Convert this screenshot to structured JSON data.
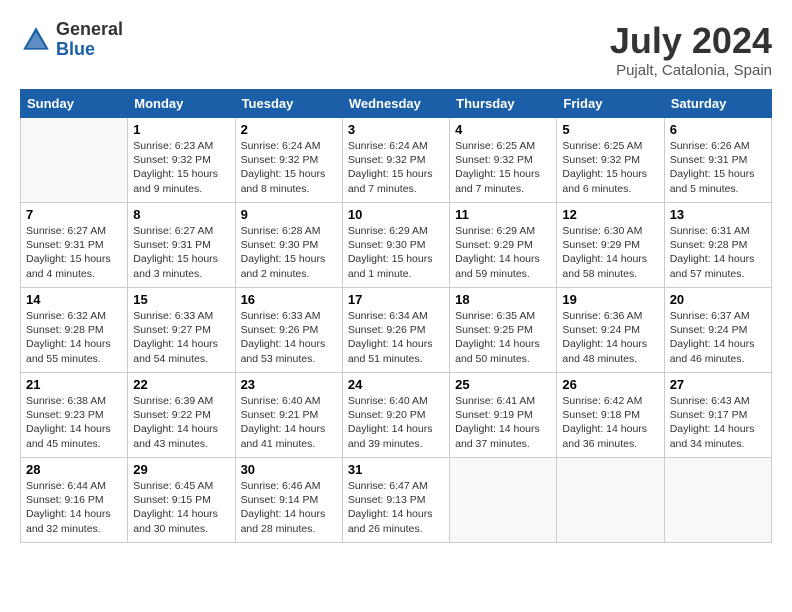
{
  "header": {
    "logo_general": "General",
    "logo_blue": "Blue",
    "month_year": "July 2024",
    "location": "Pujalt, Catalonia, Spain"
  },
  "days_of_week": [
    "Sunday",
    "Monday",
    "Tuesday",
    "Wednesday",
    "Thursday",
    "Friday",
    "Saturday"
  ],
  "weeks": [
    [
      {
        "day": "",
        "sunrise": "",
        "sunset": "",
        "daylight": ""
      },
      {
        "day": "1",
        "sunrise": "Sunrise: 6:23 AM",
        "sunset": "Sunset: 9:32 PM",
        "daylight": "Daylight: 15 hours and 9 minutes."
      },
      {
        "day": "2",
        "sunrise": "Sunrise: 6:24 AM",
        "sunset": "Sunset: 9:32 PM",
        "daylight": "Daylight: 15 hours and 8 minutes."
      },
      {
        "day": "3",
        "sunrise": "Sunrise: 6:24 AM",
        "sunset": "Sunset: 9:32 PM",
        "daylight": "Daylight: 15 hours and 7 minutes."
      },
      {
        "day": "4",
        "sunrise": "Sunrise: 6:25 AM",
        "sunset": "Sunset: 9:32 PM",
        "daylight": "Daylight: 15 hours and 7 minutes."
      },
      {
        "day": "5",
        "sunrise": "Sunrise: 6:25 AM",
        "sunset": "Sunset: 9:32 PM",
        "daylight": "Daylight: 15 hours and 6 minutes."
      },
      {
        "day": "6",
        "sunrise": "Sunrise: 6:26 AM",
        "sunset": "Sunset: 9:31 PM",
        "daylight": "Daylight: 15 hours and 5 minutes."
      }
    ],
    [
      {
        "day": "7",
        "sunrise": "Sunrise: 6:27 AM",
        "sunset": "Sunset: 9:31 PM",
        "daylight": "Daylight: 15 hours and 4 minutes."
      },
      {
        "day": "8",
        "sunrise": "Sunrise: 6:27 AM",
        "sunset": "Sunset: 9:31 PM",
        "daylight": "Daylight: 15 hours and 3 minutes."
      },
      {
        "day": "9",
        "sunrise": "Sunrise: 6:28 AM",
        "sunset": "Sunset: 9:30 PM",
        "daylight": "Daylight: 15 hours and 2 minutes."
      },
      {
        "day": "10",
        "sunrise": "Sunrise: 6:29 AM",
        "sunset": "Sunset: 9:30 PM",
        "daylight": "Daylight: 15 hours and 1 minute."
      },
      {
        "day": "11",
        "sunrise": "Sunrise: 6:29 AM",
        "sunset": "Sunset: 9:29 PM",
        "daylight": "Daylight: 14 hours and 59 minutes."
      },
      {
        "day": "12",
        "sunrise": "Sunrise: 6:30 AM",
        "sunset": "Sunset: 9:29 PM",
        "daylight": "Daylight: 14 hours and 58 minutes."
      },
      {
        "day": "13",
        "sunrise": "Sunrise: 6:31 AM",
        "sunset": "Sunset: 9:28 PM",
        "daylight": "Daylight: 14 hours and 57 minutes."
      }
    ],
    [
      {
        "day": "14",
        "sunrise": "Sunrise: 6:32 AM",
        "sunset": "Sunset: 9:28 PM",
        "daylight": "Daylight: 14 hours and 55 minutes."
      },
      {
        "day": "15",
        "sunrise": "Sunrise: 6:33 AM",
        "sunset": "Sunset: 9:27 PM",
        "daylight": "Daylight: 14 hours and 54 minutes."
      },
      {
        "day": "16",
        "sunrise": "Sunrise: 6:33 AM",
        "sunset": "Sunset: 9:26 PM",
        "daylight": "Daylight: 14 hours and 53 minutes."
      },
      {
        "day": "17",
        "sunrise": "Sunrise: 6:34 AM",
        "sunset": "Sunset: 9:26 PM",
        "daylight": "Daylight: 14 hours and 51 minutes."
      },
      {
        "day": "18",
        "sunrise": "Sunrise: 6:35 AM",
        "sunset": "Sunset: 9:25 PM",
        "daylight": "Daylight: 14 hours and 50 minutes."
      },
      {
        "day": "19",
        "sunrise": "Sunrise: 6:36 AM",
        "sunset": "Sunset: 9:24 PM",
        "daylight": "Daylight: 14 hours and 48 minutes."
      },
      {
        "day": "20",
        "sunrise": "Sunrise: 6:37 AM",
        "sunset": "Sunset: 9:24 PM",
        "daylight": "Daylight: 14 hours and 46 minutes."
      }
    ],
    [
      {
        "day": "21",
        "sunrise": "Sunrise: 6:38 AM",
        "sunset": "Sunset: 9:23 PM",
        "daylight": "Daylight: 14 hours and 45 minutes."
      },
      {
        "day": "22",
        "sunrise": "Sunrise: 6:39 AM",
        "sunset": "Sunset: 9:22 PM",
        "daylight": "Daylight: 14 hours and 43 minutes."
      },
      {
        "day": "23",
        "sunrise": "Sunrise: 6:40 AM",
        "sunset": "Sunset: 9:21 PM",
        "daylight": "Daylight: 14 hours and 41 minutes."
      },
      {
        "day": "24",
        "sunrise": "Sunrise: 6:40 AM",
        "sunset": "Sunset: 9:20 PM",
        "daylight": "Daylight: 14 hours and 39 minutes."
      },
      {
        "day": "25",
        "sunrise": "Sunrise: 6:41 AM",
        "sunset": "Sunset: 9:19 PM",
        "daylight": "Daylight: 14 hours and 37 minutes."
      },
      {
        "day": "26",
        "sunrise": "Sunrise: 6:42 AM",
        "sunset": "Sunset: 9:18 PM",
        "daylight": "Daylight: 14 hours and 36 minutes."
      },
      {
        "day": "27",
        "sunrise": "Sunrise: 6:43 AM",
        "sunset": "Sunset: 9:17 PM",
        "daylight": "Daylight: 14 hours and 34 minutes."
      }
    ],
    [
      {
        "day": "28",
        "sunrise": "Sunrise: 6:44 AM",
        "sunset": "Sunset: 9:16 PM",
        "daylight": "Daylight: 14 hours and 32 minutes."
      },
      {
        "day": "29",
        "sunrise": "Sunrise: 6:45 AM",
        "sunset": "Sunset: 9:15 PM",
        "daylight": "Daylight: 14 hours and 30 minutes."
      },
      {
        "day": "30",
        "sunrise": "Sunrise: 6:46 AM",
        "sunset": "Sunset: 9:14 PM",
        "daylight": "Daylight: 14 hours and 28 minutes."
      },
      {
        "day": "31",
        "sunrise": "Sunrise: 6:47 AM",
        "sunset": "Sunset: 9:13 PM",
        "daylight": "Daylight: 14 hours and 26 minutes."
      },
      {
        "day": "",
        "sunrise": "",
        "sunset": "",
        "daylight": ""
      },
      {
        "day": "",
        "sunrise": "",
        "sunset": "",
        "daylight": ""
      },
      {
        "day": "",
        "sunrise": "",
        "sunset": "",
        "daylight": ""
      }
    ]
  ]
}
